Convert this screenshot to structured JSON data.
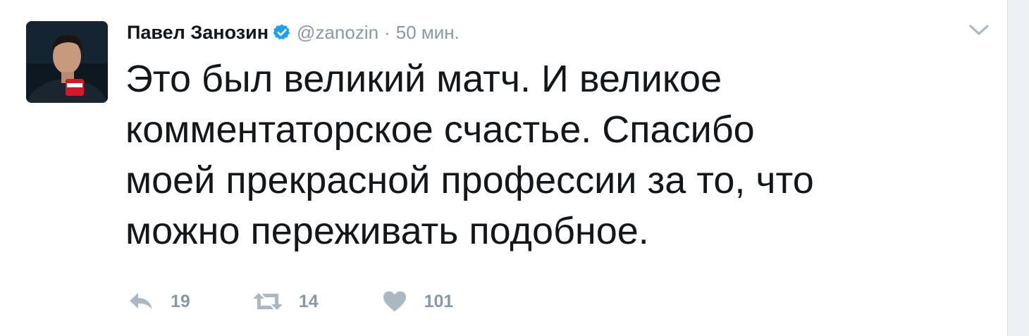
{
  "author": {
    "name": "Павел Занозин",
    "handle": "@zanozin",
    "separator": "·",
    "timestamp": "50 мин.",
    "verified": true
  },
  "tweet": {
    "text_lines": [
      "Это был великий матч. И великое",
      "комментаторское счастье. Спасибо",
      "моей прекрасной профессии за то, что",
      "можно переживать подобное."
    ]
  },
  "actions": {
    "reply_count": "19",
    "retweet_count": "14",
    "like_count": "101"
  },
  "icons": {
    "verified": "verified-badge-icon",
    "caret": "chevron-down-icon",
    "reply": "reply-icon",
    "retweet": "retweet-icon",
    "like": "heart-icon"
  },
  "colors": {
    "verified_blue": "#1da1f2",
    "text_primary": "#14171a",
    "text_secondary": "#8899a6"
  }
}
